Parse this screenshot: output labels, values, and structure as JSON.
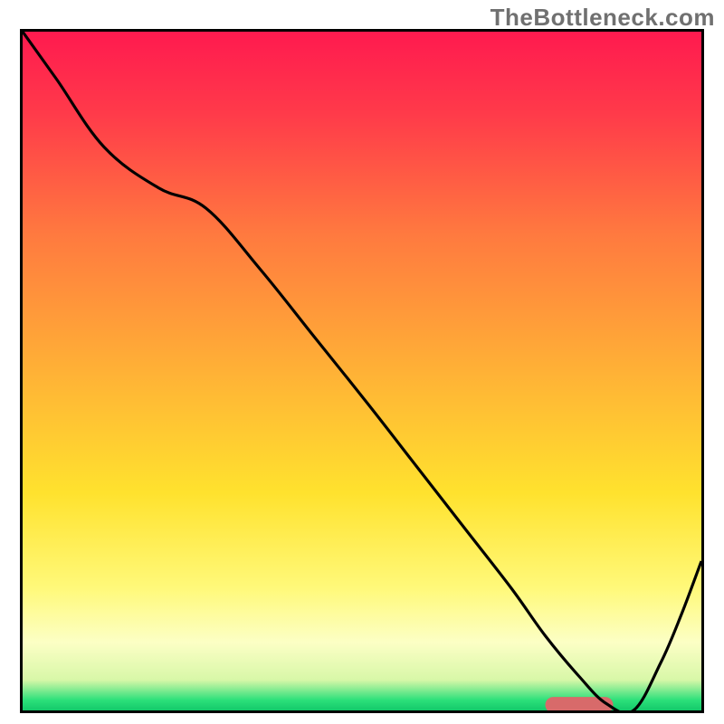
{
  "watermark": "TheBottleneck.com",
  "colors": {
    "gradient_stops": [
      {
        "offset": 0.0,
        "color": "#ff1a4f"
      },
      {
        "offset": 0.12,
        "color": "#ff3a4a"
      },
      {
        "offset": 0.3,
        "color": "#ff7a3f"
      },
      {
        "offset": 0.5,
        "color": "#ffb136"
      },
      {
        "offset": 0.68,
        "color": "#ffe22e"
      },
      {
        "offset": 0.82,
        "color": "#fff97a"
      },
      {
        "offset": 0.9,
        "color": "#fcffc5"
      },
      {
        "offset": 0.955,
        "color": "#d8f7a8"
      },
      {
        "offset": 0.985,
        "color": "#2be07a"
      },
      {
        "offset": 1.0,
        "color": "#14c96a"
      }
    ],
    "marker_color": "#d86a6a",
    "curve_color": "#000000"
  },
  "chart_data": {
    "type": "line",
    "title": "",
    "xlabel": "",
    "ylabel": "",
    "xlim": [
      0,
      100
    ],
    "ylim": [
      0,
      100
    ],
    "x": [
      0,
      5,
      12,
      20,
      27,
      35,
      43,
      51,
      58,
      65,
      72,
      77,
      82,
      86,
      90,
      94,
      97,
      100
    ],
    "values": [
      100,
      93,
      83,
      77,
      74,
      65,
      55,
      45,
      36,
      27,
      18,
      11,
      5,
      1,
      0,
      7,
      14,
      22
    ],
    "annotations": [
      {
        "name": "optimal-marker",
        "x0": 77,
        "x1": 87,
        "y": 0.8
      }
    ],
    "notes": "Curve read off visually; values approximate. Gradient background runs red (high y) to green (y≈0)."
  }
}
